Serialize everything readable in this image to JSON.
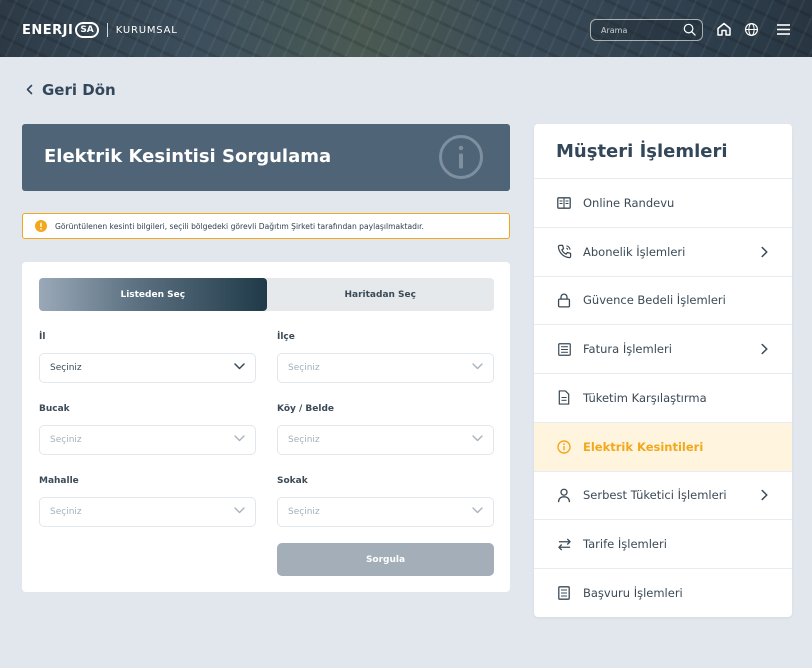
{
  "header": {
    "logo_text": "ENERJI",
    "logo_badge": "SA",
    "logo_sub": "KURUMSAL",
    "search_placeholder": "Arama",
    "icons": [
      "search-icon",
      "home-icon",
      "globe-icon",
      "menu-icon"
    ]
  },
  "back": {
    "label": "Geri Dön"
  },
  "banner": {
    "title": "Elektrik Kesintisi Sorgulama"
  },
  "notice": {
    "text": "Görüntülenen kesinti bilgileri, seçili bölgedeki görevli Dağıtım Şirketi tarafından paylaşılmaktadır."
  },
  "form": {
    "tabs": [
      "Listeden Seç",
      "Haritadan Seç"
    ],
    "active_tab": 0,
    "fields": [
      {
        "label": "İl",
        "value": "Seçiniz",
        "disabled": false
      },
      {
        "label": "İlçe",
        "value": "Seçiniz",
        "disabled": true
      },
      {
        "label": "Bucak",
        "value": "Seçiniz",
        "disabled": true
      },
      {
        "label": "Köy / Belde",
        "value": "Seçiniz",
        "disabled": true
      },
      {
        "label": "Mahalle",
        "value": "Seçiniz",
        "disabled": true
      },
      {
        "label": "Sokak",
        "value": "Seçiniz",
        "disabled": true
      }
    ],
    "submit_label": "Sorgula"
  },
  "side_menu": {
    "title": "Müşteri İşlemleri",
    "items": [
      {
        "label": "Online Randevu",
        "icon": "calendar-icon",
        "chevron": false,
        "active": false
      },
      {
        "label": "Abonelik İşlemleri",
        "icon": "phone-icon",
        "chevron": true,
        "active": false
      },
      {
        "label": "Güvence Bedeli İşlemleri",
        "icon": "lock-icon",
        "chevron": false,
        "active": false
      },
      {
        "label": "Fatura İşlemleri",
        "icon": "invoice-icon",
        "chevron": true,
        "active": false
      },
      {
        "label": "Tüketim Karşılaştırma",
        "icon": "document-icon",
        "chevron": false,
        "active": false
      },
      {
        "label": "Elektrik Kesintileri",
        "icon": "info-icon",
        "chevron": false,
        "active": true
      },
      {
        "label": "Serbest Tüketici İşlemleri",
        "icon": "user-icon",
        "chevron": true,
        "active": false
      },
      {
        "label": "Tarife İşlemleri",
        "icon": "swap-icon",
        "chevron": false,
        "active": false
      },
      {
        "label": "Başvuru İşlemleri",
        "icon": "form-icon",
        "chevron": false,
        "active": false
      }
    ]
  },
  "colors": {
    "accent": "#f2a81d",
    "banner": "#4f6476",
    "background": "#e2e7ee",
    "active_tab_dark": "#203a49"
  }
}
